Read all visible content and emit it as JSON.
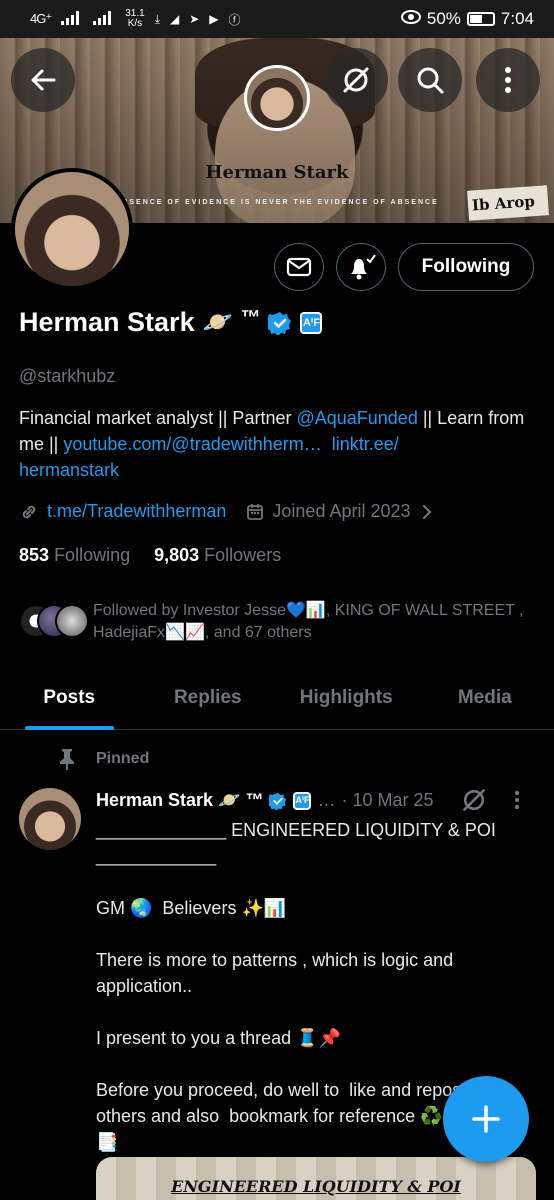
{
  "status_bar": {
    "network": "4G⁺",
    "speed_value": "31.1",
    "speed_unit": "K/s",
    "battery": "50%",
    "time": "7:04"
  },
  "banner": {
    "name": "Herman Stark",
    "tagline": "ABSENCE OF EVIDENCE IS NEVER THE EVIDENCE OF ABSENCE",
    "corner_text": "Ib Arop"
  },
  "profile": {
    "display_name": "Herman Stark",
    "name_emoji": "🪐",
    "tm": "™",
    "af_badge": "AⁱF",
    "handle": "@starkhubz",
    "following_button": "Following",
    "bio": {
      "part1": "Financial market analyst || Partner ",
      "mention": "@AquaFunded",
      "part2": " || Learn from me || ",
      "link1": "youtube.com/@tradewithherm…",
      "link2": "linktr.ee/",
      "link3": "hermanstark"
    },
    "website": "t.me/Tradewithherman",
    "joined": "Joined April 2023",
    "following_count": "853",
    "following_label": "Following",
    "followers_count": "9,803",
    "followers_label": "Followers",
    "followed_by": "Followed by Investor Jesse💙📊, KING OF WALL STREET , HadejiaFx📉📈, and 67 others"
  },
  "tabs": [
    {
      "label": "Posts"
    },
    {
      "label": "Replies"
    },
    {
      "label": "Highlights"
    },
    {
      "label": "Media"
    }
  ],
  "post": {
    "pinned_label": "Pinned",
    "author": "Herman Stark 🪐 ™",
    "af_badge": "AⁱF",
    "ellipsis": "…",
    "date": "· 10 Mar 25",
    "body": "_____________ ENGINEERED LIQUIDITY & POI\n____________\n\nGM 🌏  Believers ✨📊\n\nThere is more to patterns , which is logic and application..\n\nI present to you a thread 🧵📌\n\nBefore you proceed, do well to  like and repost for others and also  bookmark for reference ♻️\n📑",
    "image_title": "ENGINEERED LIQUIDITY & POI"
  },
  "colors": {
    "accent": "#1d9bf0",
    "muted": "#71767b",
    "background": "#000000"
  }
}
